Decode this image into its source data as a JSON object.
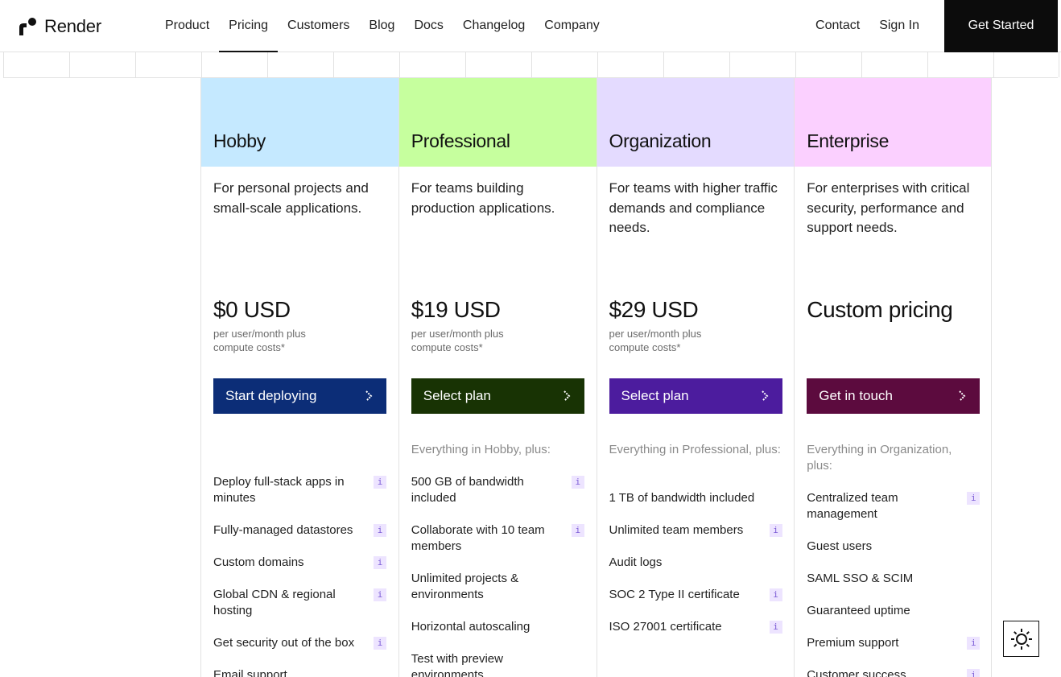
{
  "brand": {
    "name": "Render"
  },
  "nav": {
    "items": [
      "Product",
      "Pricing",
      "Customers",
      "Blog",
      "Docs",
      "Changelog",
      "Company"
    ],
    "active": "Pricing",
    "right": [
      "Contact",
      "Sign In"
    ],
    "cta": "Get Started"
  },
  "plans": [
    {
      "name": "Hobby",
      "head_color": "#c5e9ff",
      "button_color": "#0c2d77",
      "description": "For personal projects and small-scale applications.",
      "price": "$0 USD",
      "price_note": "per user/month plus compute costs*",
      "button_label": "Start deploying",
      "intro": "",
      "features": [
        {
          "label": "Deploy full-stack apps in minutes",
          "info": true
        },
        {
          "label": "Fully-managed datastores",
          "info": true
        },
        {
          "label": "Custom domains",
          "info": true
        },
        {
          "label": "Global CDN & regional hosting",
          "info": true
        },
        {
          "label": "Get security out of the box",
          "info": true
        },
        {
          "label": "Email support",
          "info": false
        }
      ]
    },
    {
      "name": "Professional",
      "head_color": "#c6ff9e",
      "button_color": "#183304",
      "description": "For teams building production applications.",
      "price": "$19 USD",
      "price_note": "per user/month plus compute costs*",
      "button_label": "Select plan",
      "intro": "Everything in Hobby, plus:",
      "features": [
        {
          "label": "500 GB of bandwidth included",
          "info": true
        },
        {
          "label": "Collaborate with 10 team members",
          "info": true
        },
        {
          "label": "Unlimited projects & environments",
          "info": false
        },
        {
          "label": "Horizontal autoscaling",
          "info": false
        },
        {
          "label": "Test with preview environments",
          "info": false
        }
      ]
    },
    {
      "name": "Organization",
      "head_color": "#e4dbff",
      "button_color": "#4c1c9e",
      "description": "For teams with higher traffic demands and compliance needs.",
      "price": "$29 USD",
      "price_note": "per user/month plus compute costs*",
      "button_label": "Select plan",
      "intro": "Everything in Professional, plus:",
      "features": [
        {
          "label": "1 TB of bandwidth included",
          "info": false
        },
        {
          "label": "Unlimited team members",
          "info": true
        },
        {
          "label": "Audit logs",
          "info": false
        },
        {
          "label": "SOC 2 Type II certificate",
          "info": true
        },
        {
          "label": "ISO 27001 certificate",
          "info": true
        }
      ]
    },
    {
      "name": "Enterprise",
      "head_color": "#fbd0ff",
      "button_color": "#5c0b3e",
      "description": "For enterprises with critical security, performance and support needs.",
      "price": "Custom pricing",
      "price_note": "",
      "button_label": "Get in touch",
      "intro": "Everything in Organization, plus:",
      "features": [
        {
          "label": "Centralized team management",
          "info": true
        },
        {
          "label": "Guest users",
          "info": false
        },
        {
          "label": "SAML SSO & SCIM",
          "info": false
        },
        {
          "label": "Guaranteed uptime",
          "info": false
        },
        {
          "label": "Premium support",
          "info": true
        },
        {
          "label": "Customer success",
          "info": true
        }
      ]
    }
  ],
  "info_glyph": "i",
  "icons": {
    "theme_toggle": "sun-icon",
    "chevron": "chevron-right-icon",
    "info": "info-icon"
  }
}
